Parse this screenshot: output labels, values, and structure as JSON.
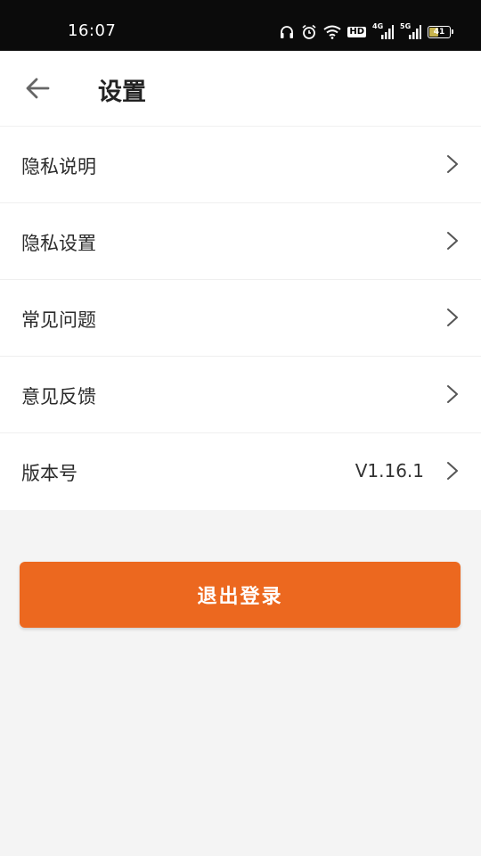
{
  "status_bar": {
    "time": "16:07",
    "icons": [
      "headset-icon",
      "alarm-icon",
      "wifi-icon",
      "hd-icon",
      "4g-signal-icon",
      "5g-signal-icon",
      "battery-icon"
    ],
    "hd_label": "HD",
    "net1_label": "4G",
    "net2_label": "5G",
    "battery_level": "41"
  },
  "header": {
    "title": "设置",
    "back_icon": "arrow-left-icon"
  },
  "menu": {
    "items": [
      {
        "label": "隐私说明",
        "value": ""
      },
      {
        "label": "隐私设置",
        "value": ""
      },
      {
        "label": "常见问题",
        "value": ""
      },
      {
        "label": "意见反馈",
        "value": ""
      },
      {
        "label": "版本号",
        "value": "V1.16.1"
      }
    ],
    "chevron_icon": "chevron-right-icon"
  },
  "logout": {
    "label": "退出登录"
  },
  "colors": {
    "accent": "#ec681f",
    "background": "#f4f4f4",
    "status_bar": "#0b0b0b"
  }
}
